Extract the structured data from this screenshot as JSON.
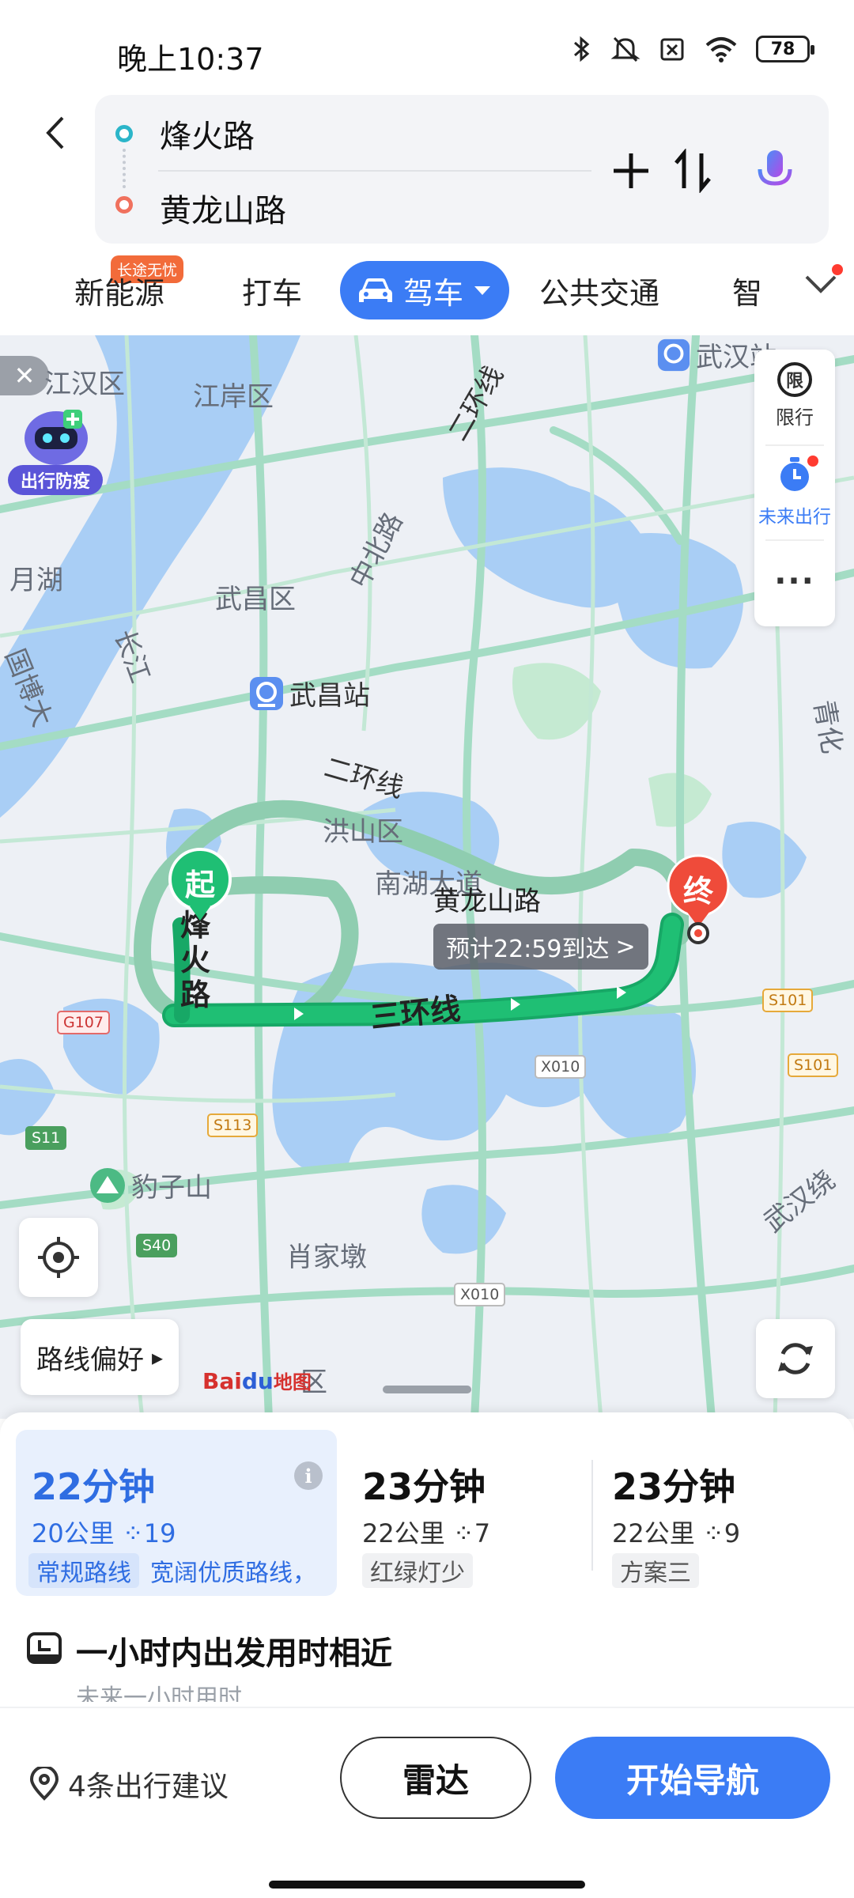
{
  "status_bar": {
    "time": "晚上10:37",
    "battery": "78",
    "icons": [
      "bluetooth-icon",
      "mute-icon",
      "sim-off-icon",
      "wifi-icon",
      "battery-icon"
    ]
  },
  "route": {
    "start": "烽火路",
    "end": "黄龙山路",
    "start_color": "#2bb5c9",
    "end_color": "#f0715e"
  },
  "tabs": {
    "items": [
      "新能源",
      "打车",
      "驾车",
      "公共交通",
      "智"
    ],
    "active": "驾车",
    "badge": "长途无忧"
  },
  "map": {
    "labels": {
      "jianghan": "江汉区",
      "jiangan": "江岸区",
      "yuehu": "月湖",
      "wuchang": "武昌区",
      "wuchang_station": "武昌站",
      "hongshan": "洪山区",
      "nanhu": "南湖大道",
      "huanglongshan": "黄龙山路",
      "baozishan": "豹子山",
      "xiaojiadun": "肖家墩",
      "wuhan_station": "武汉站",
      "ring1": "二环线",
      "ring1_s": "二环线",
      "ring3": "三环线",
      "zhongbei": "中北路",
      "changjiang": "长江",
      "guobo": "国博大",
      "qingha": "青化",
      "wuhan_ring": "武汉绕",
      "start_road": "烽火路",
      "district_bottom": "区"
    },
    "signs": {
      "g107": "G107",
      "s113": "S113",
      "s11": "S11",
      "s40": "S40",
      "x010a": "X010",
      "x010b": "X010",
      "s101a": "S101",
      "s101b": "S101"
    },
    "start_marker": "起",
    "end_marker": "终",
    "eta": "预计22:59到达",
    "eta_arrow": ">",
    "panel": {
      "restrict_glyph": "限",
      "restrict": "限行",
      "future": "未来出行",
      "more": "···"
    },
    "epidemic": "出行防疫",
    "close": "✕",
    "route_pref": "路线偏好",
    "route_pref_arrow": "▸",
    "baidu_bai": "Bai",
    "baidu_du": "du",
    "baidu_map": "地图",
    "route_color": "#1fbf74",
    "alt_route_color": "#8fcdb0"
  },
  "routes": [
    {
      "time": "22分钟",
      "distance": "20公里 ⁘19",
      "tags": [
        "常规路线",
        "宽阔优质路线，"
      ],
      "info": "i"
    },
    {
      "time": "23分钟",
      "distance": "22公里 ⁘7",
      "tags": [
        "红绿灯少"
      ]
    },
    {
      "time": "23分钟",
      "distance": "22公里 ⁘9",
      "tags": [
        "方案三"
      ]
    }
  ],
  "hour": {
    "title": "一小时内出发用时相近",
    "subtitle": "未来一小时用时"
  },
  "bottom": {
    "advice": "4条出行建议",
    "radar": "雷达",
    "navigate": "开始导航",
    "accent": "#3b7cf5"
  }
}
